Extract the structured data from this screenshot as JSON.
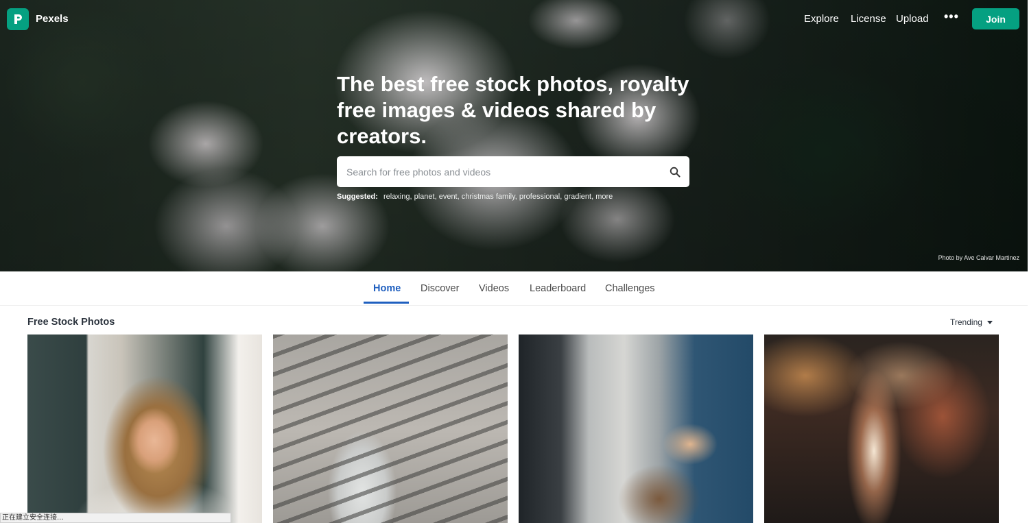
{
  "brand": {
    "name": "Pexels",
    "color": "#05a081",
    "logo_icon": "pexels-logo-icon"
  },
  "nav": {
    "links": [
      "Explore",
      "License",
      "Upload"
    ],
    "more_icon": "more-dots-icon",
    "join_label": "Join"
  },
  "hero": {
    "title": "The best free stock photos, royalty free images & videos shared by creators.",
    "search_placeholder": "Search for free photos and videos",
    "search_icon": "search-icon",
    "suggested_label": "Suggested:",
    "suggested_tags": [
      "relaxing,",
      "planet,",
      "event,",
      "christmas family,",
      "professional,",
      "gradient,",
      "more"
    ],
    "photo_credit": "Photo by Ave Calvar Martinez"
  },
  "tabs": {
    "items": [
      "Home",
      "Discover",
      "Videos",
      "Leaderboard",
      "Challenges"
    ],
    "active": "Home",
    "active_color": "#1f5fbf"
  },
  "section": {
    "title": "Free Stock Photos",
    "sort_label": "Trending"
  },
  "status_bar": {
    "text": "正在建立安全连接..."
  }
}
